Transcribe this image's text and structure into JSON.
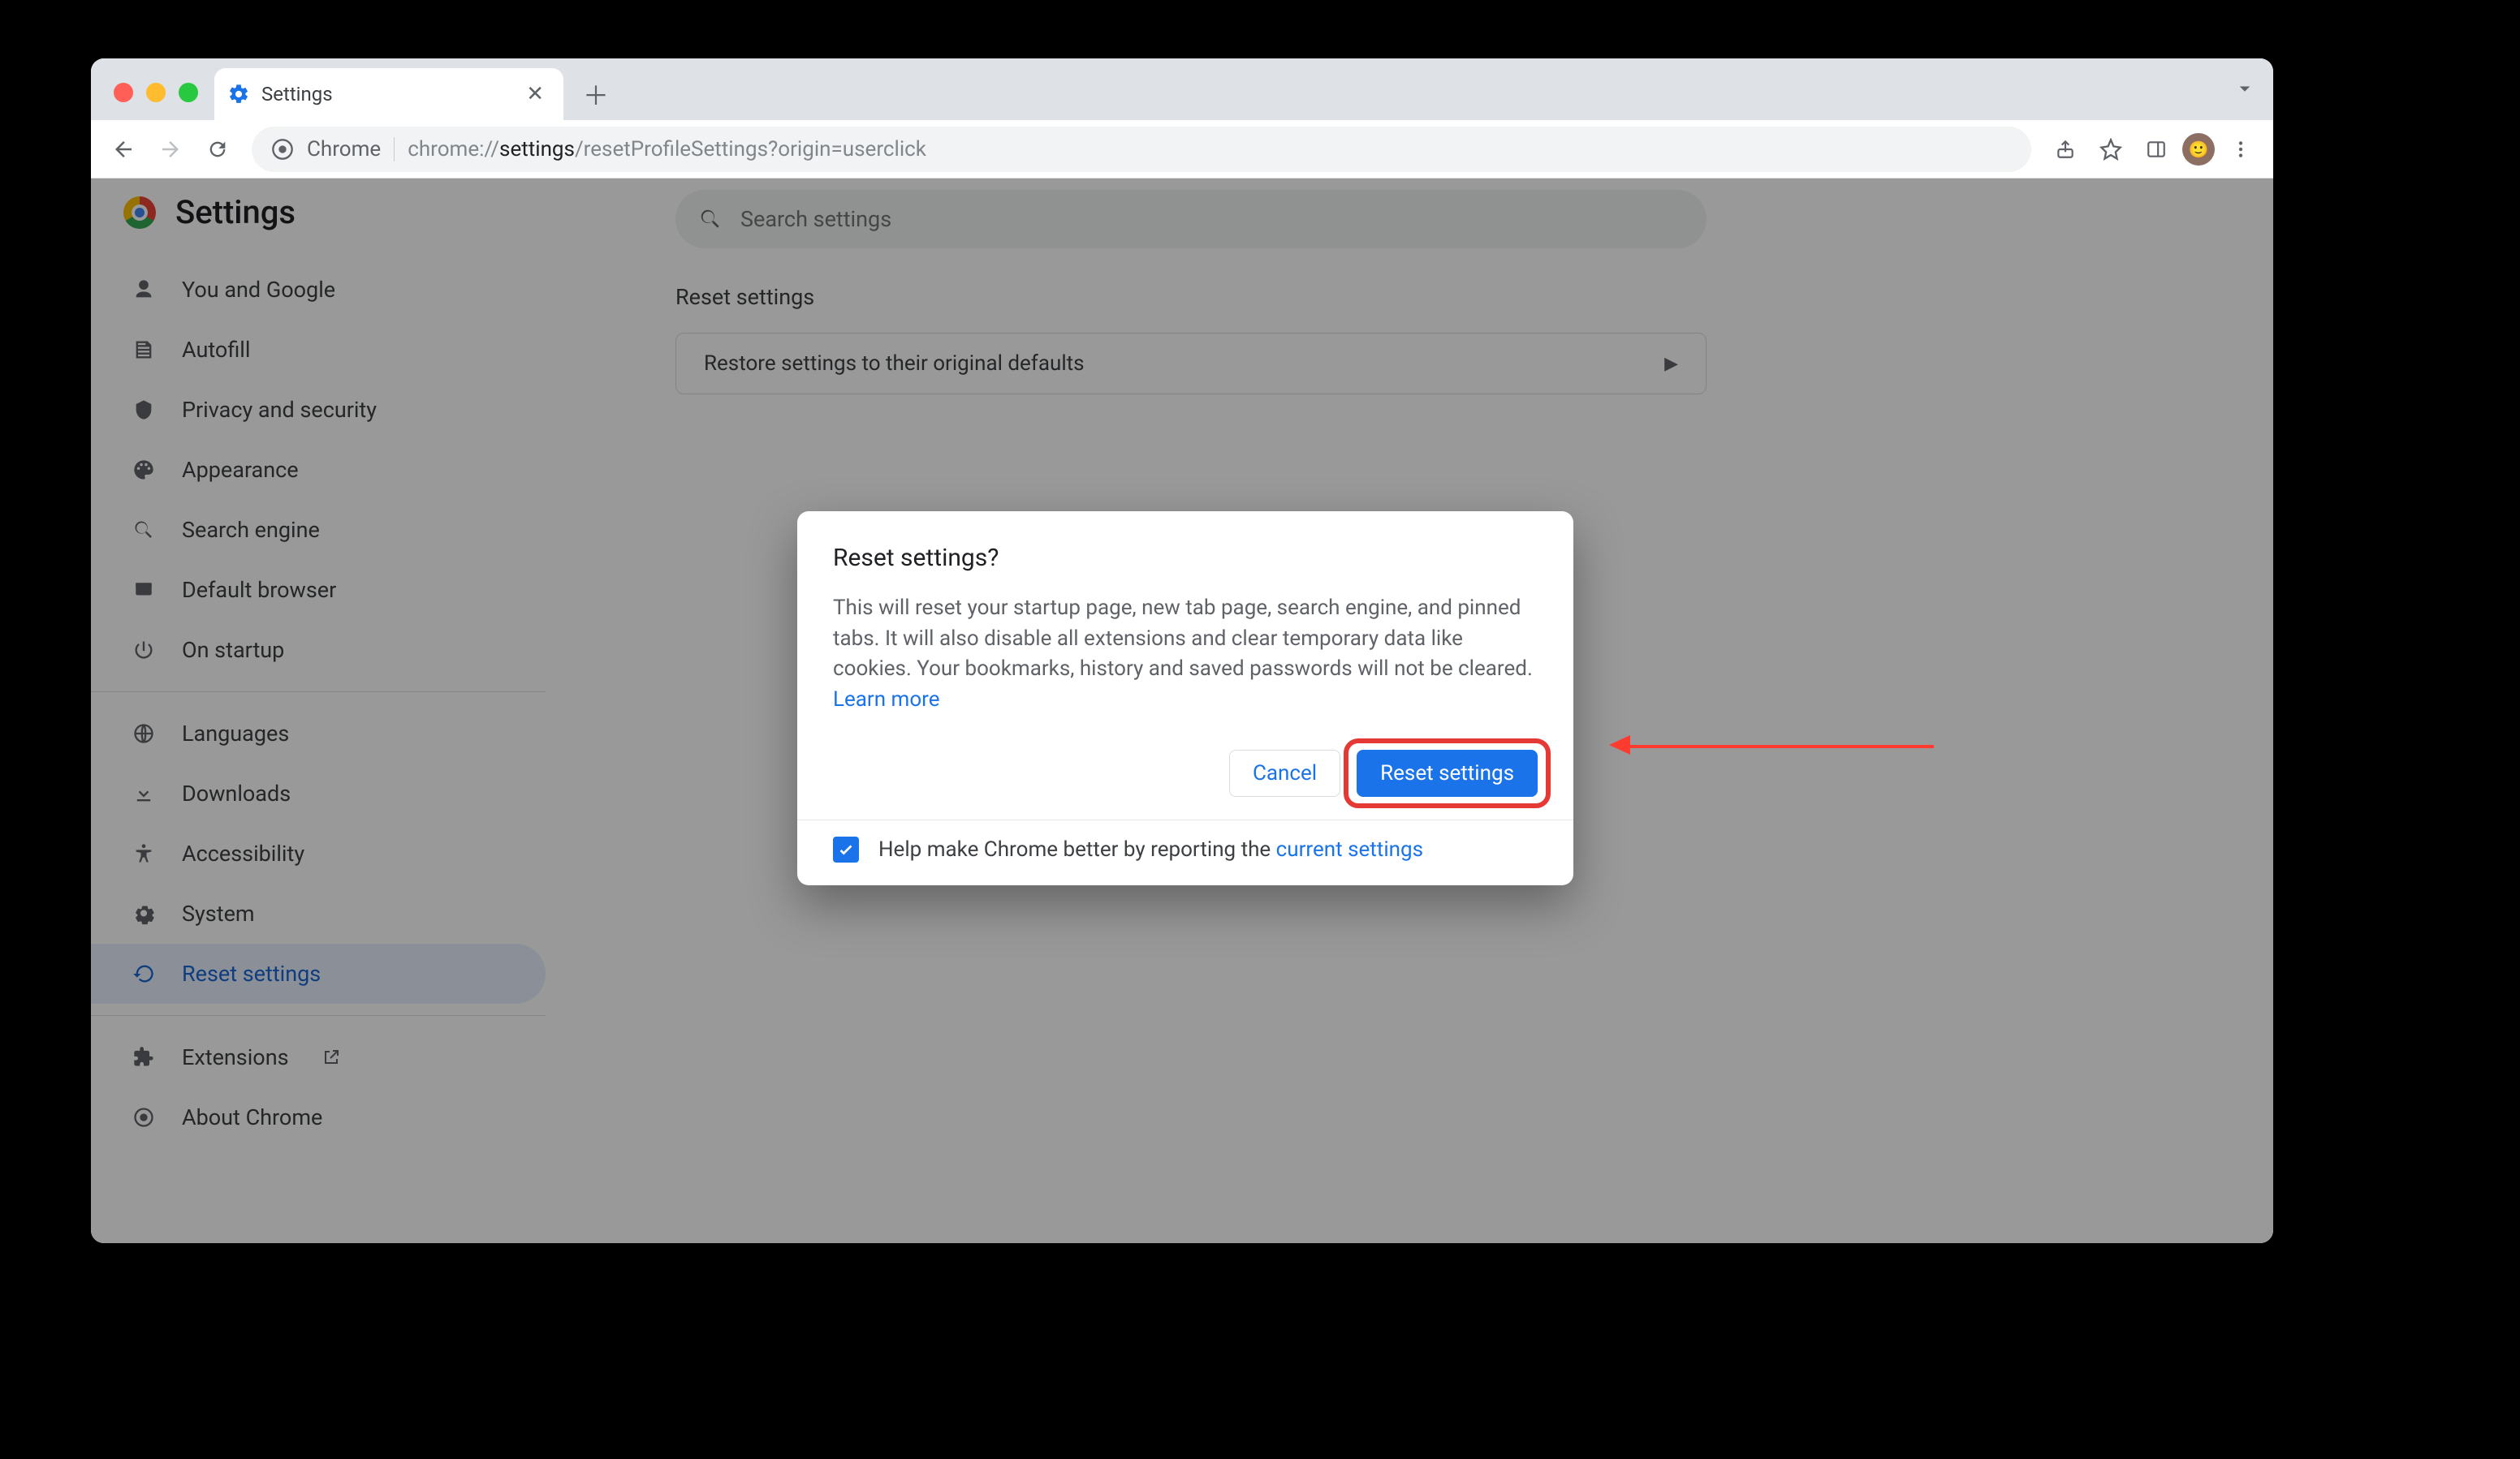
{
  "browser": {
    "tab_title": "Settings",
    "omnibox_prefix": "Chrome",
    "url_light_pre": "chrome://",
    "url_bold": "settings",
    "url_light_post": "/resetProfileSettings?origin=userclick"
  },
  "settings_header": {
    "title": "Settings"
  },
  "search": {
    "placeholder": "Search settings"
  },
  "sidebar": {
    "group1": [
      {
        "key": "you-google",
        "label": "You and Google"
      },
      {
        "key": "autofill",
        "label": "Autofill"
      },
      {
        "key": "privacy",
        "label": "Privacy and security"
      },
      {
        "key": "appearance",
        "label": "Appearance"
      },
      {
        "key": "search-engine",
        "label": "Search engine"
      },
      {
        "key": "default-browser",
        "label": "Default browser"
      },
      {
        "key": "startup",
        "label": "On startup"
      }
    ],
    "group2": [
      {
        "key": "languages",
        "label": "Languages"
      },
      {
        "key": "downloads",
        "label": "Downloads"
      },
      {
        "key": "accessibility",
        "label": "Accessibility"
      },
      {
        "key": "system",
        "label": "System"
      },
      {
        "key": "reset",
        "label": "Reset settings",
        "active": true
      }
    ],
    "group3": [
      {
        "key": "extensions",
        "label": "Extensions",
        "external": true
      },
      {
        "key": "about",
        "label": "About Chrome"
      }
    ]
  },
  "main": {
    "section_title": "Reset settings",
    "row_label": "Restore settings to their original defaults"
  },
  "dialog": {
    "title": "Reset settings?",
    "body_text": "This will reset your startup page, new tab page, search engine, and pinned tabs. It will also disable all extensions and clear temporary data like cookies. Your bookmarks, history and saved passwords will not be cleared. ",
    "learn_more": "Learn more",
    "cancel": "Cancel",
    "confirm": "Reset settings",
    "footer_text": "Help make Chrome better by reporting the ",
    "footer_link": "current settings",
    "checkbox_checked": true
  }
}
